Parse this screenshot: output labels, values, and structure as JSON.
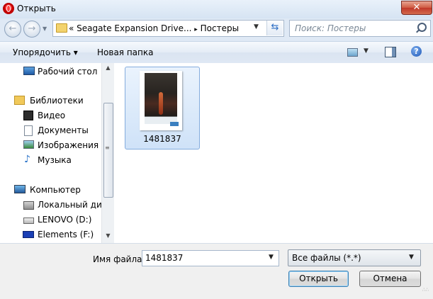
{
  "window": {
    "title": "Открыть",
    "close_label": "✕"
  },
  "navigation": {
    "back_label": "←",
    "forward_label": "→",
    "address_prefix": "«",
    "breadcrumb": [
      "Seagate Expansion Drive...",
      "Постеры"
    ],
    "breadcrumb_separator": "▸",
    "search_placeholder": "Поиск: Постеры"
  },
  "command_bar": {
    "organize_label": "Упорядочить ▾",
    "new_folder_label": "Новая папка",
    "help_label": "?"
  },
  "nav_pane": {
    "items": [
      {
        "label": "Рабочий стол",
        "icon": "desktop-icon"
      },
      {
        "label": "Библиотеки",
        "icon": "libraries-icon"
      },
      {
        "label": "Видео",
        "icon": "video-icon"
      },
      {
        "label": "Документы",
        "icon": "documents-icon"
      },
      {
        "label": "Изображения",
        "icon": "pictures-icon"
      },
      {
        "label": "Музыка",
        "icon": "music-icon"
      },
      {
        "label": "Компьютер",
        "icon": "computer-icon"
      },
      {
        "label": "Локальный диск",
        "icon": "local-disk-icon"
      },
      {
        "label": "LENOVO (D:)",
        "icon": "drive-icon"
      },
      {
        "label": "Elements (F:)",
        "icon": "wd-drive-icon"
      }
    ]
  },
  "content": {
    "files": [
      {
        "name": "1481837",
        "type": "image",
        "selected": true
      }
    ]
  },
  "footer": {
    "filename_label": "Имя файла:",
    "filename_value": "1481837",
    "filter_value": "Все файлы (*.*)",
    "open_label": "Открыть",
    "cancel_label": "Отмена"
  },
  "colors": {
    "accent": "#3c7fb1",
    "selection_border": "#84acdd",
    "chrome": "#dfe9f5"
  }
}
